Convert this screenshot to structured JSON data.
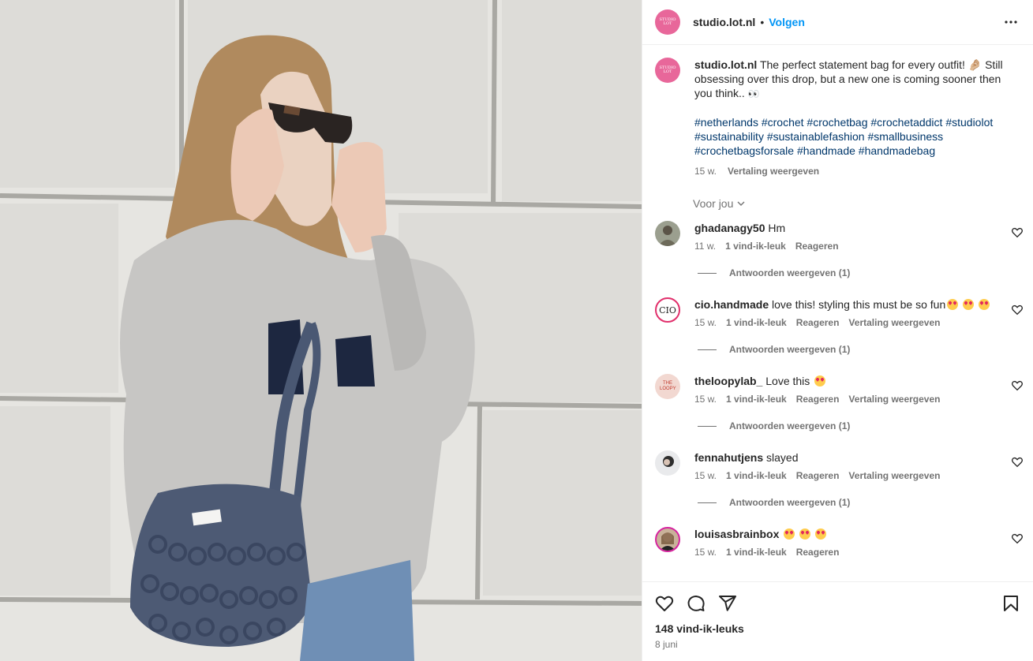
{
  "post": {
    "author": "studio.lot.nl",
    "follow_label": "Volgen",
    "dot": "•",
    "avatar_text": "STUDIO LOT",
    "caption": {
      "username": "studio.lot.nl",
      "text": "The perfect statement bag for every outfit! 🤌🏼 Still obsessing over this drop, but a new one is coming sooner then you think..",
      "eyes": "👀",
      "hashtags": "#netherlands #crochet #crochetbag #crochetaddict #studiolot #sustainability #sustainablefashion #smallbusiness #crochetbagsforsale #handmade #handmadebag",
      "time": "15 w.",
      "translate": "Vertaling weergeven"
    },
    "for_you": "Voor jou",
    "bag_label": "STUDIO LOT",
    "likes": "148 vind-ik-leuks",
    "date": "8 juni"
  },
  "comments": [
    {
      "username": "ghadanagy50",
      "text": "Hm",
      "time": "11 w.",
      "likes": "1 vind-ik-leuk",
      "reply": "Reageren",
      "translate": "",
      "replies": "Antwoorden weergeven (1)",
      "emojis": 0
    },
    {
      "username": "cio.handmade",
      "text": "love this! styling this must be so fun",
      "time": "15 w.",
      "likes": "1 vind-ik-leuk",
      "reply": "Reageren",
      "translate": "Vertaling weergeven",
      "replies": "Antwoorden weergeven (1)",
      "emojis": 3,
      "avatar_text": "CIO"
    },
    {
      "username": "theloopylab_",
      "text": "Love this",
      "time": "15 w.",
      "likes": "1 vind-ik-leuk",
      "reply": "Reageren",
      "translate": "Vertaling weergeven",
      "replies": "Antwoorden weergeven (1)",
      "emojis": 1,
      "avatar_text": "THE LOOPY"
    },
    {
      "username": "fennahutjens",
      "text": "slayed",
      "time": "15 w.",
      "likes": "1 vind-ik-leuk",
      "reply": "Reageren",
      "translate": "Vertaling weergeven",
      "replies": "Antwoorden weergeven (1)",
      "emojis": 0
    },
    {
      "username": "louisasbrainbox",
      "text": "",
      "time": "15 w.",
      "likes": "1 vind-ik-leuk",
      "reply": "Reageren",
      "translate": "",
      "replies": "",
      "emojis": 3
    }
  ],
  "colors": {
    "brand_pink": "#e8679a",
    "follow_blue": "#0095f6",
    "hashtag": "#00376b",
    "muted": "#737373"
  },
  "icons": [
    "more-icon",
    "heart-icon",
    "comment-icon",
    "share-icon",
    "bookmark-icon",
    "chevron-down-icon"
  ]
}
